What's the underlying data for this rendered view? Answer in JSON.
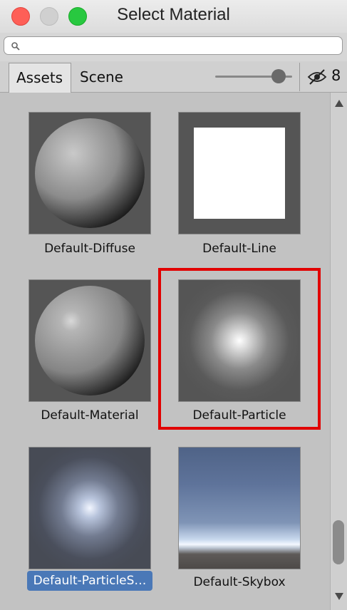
{
  "window": {
    "title": "Select Material"
  },
  "search": {
    "value": "",
    "placeholder": ""
  },
  "tabs": [
    {
      "label": "Assets"
    },
    {
      "label": "Scene"
    }
  ],
  "zoom_slider": {
    "value": 0.85
  },
  "hidden_count": "8",
  "materials": [
    {
      "label": "Default-Diffuse",
      "preview": "sphere-diffuse"
    },
    {
      "label": "Default-Line",
      "preview": "white-square"
    },
    {
      "label": "Default-Material",
      "preview": "sphere-specular"
    },
    {
      "label": "Default-Particle",
      "preview": "soft-glow",
      "highlighted": true
    },
    {
      "label": "Default-ParticleS…",
      "preview": "soft-glow-blue",
      "selected": true
    },
    {
      "label": "Default-Skybox",
      "preview": "skybox"
    }
  ],
  "colors": {
    "highlight": "#e10000",
    "selection": "#4a78b7"
  }
}
